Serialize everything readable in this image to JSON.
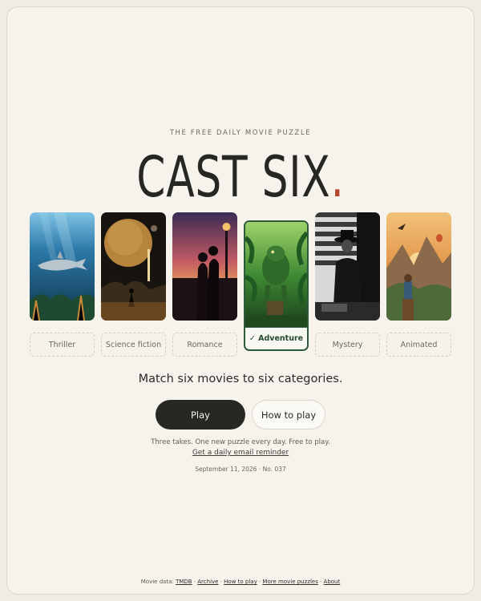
{
  "header": {
    "eyebrow": "THE FREE DAILY MOVIE PUZZLE",
    "title": "CAST SIX",
    "title_dot": "."
  },
  "categories": [
    {
      "label": "Thriller",
      "selected": false
    },
    {
      "label": "Science fiction",
      "selected": false
    },
    {
      "label": "Romance",
      "selected": false
    },
    {
      "label": "✓ Adventure",
      "selected": true
    },
    {
      "label": "Mystery",
      "selected": false
    },
    {
      "label": "Animated",
      "selected": false
    }
  ],
  "main": {
    "prompt": "Match six movies to six categories.",
    "play_label": "Play",
    "how_label": "How to play",
    "tagline": "Three takes. One new puzzle every day. Free to play.",
    "reminder_link": "Get a daily email reminder",
    "date_line": "September 11, 2026 · No. 037"
  },
  "footer": {
    "prefix": "Movie data:",
    "tmdb": "TMDB",
    "archive": "Archive",
    "how": "How to play",
    "more": "More movie puzzles",
    "about": "About",
    "sep": " · "
  },
  "colors": {
    "accent_dot": "#b4472c",
    "selected_border": "#2b5b3a",
    "play_bg": "#272823"
  }
}
